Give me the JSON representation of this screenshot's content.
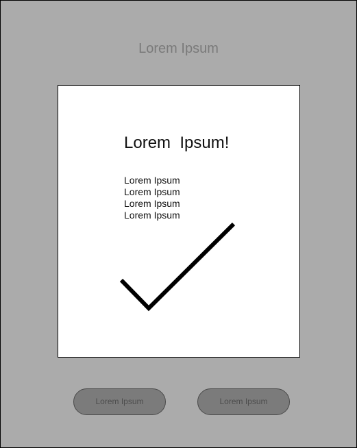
{
  "header": {
    "title": "Lorem Ipsum"
  },
  "card": {
    "heading": "Lorem  Ipsum!",
    "lines": [
      "Lorem Ipsum",
      "Lorem Ipsum",
      "Lorem Ipsum",
      "Lorem Ipsum"
    ],
    "icon": "checkmark-icon"
  },
  "buttons": {
    "left_label": "Lorem Ipsum",
    "right_label": "Lorem Ipsum"
  },
  "colors": {
    "background": "#ababab",
    "card": "#ffffff",
    "button": "#7b7b7b",
    "title_text": "#7a7a7a"
  }
}
